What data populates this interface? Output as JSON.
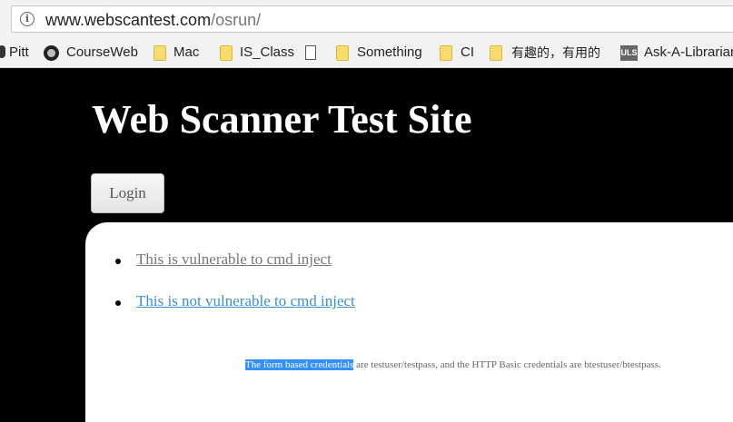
{
  "browser": {
    "url_host": "www.webscantest.com",
    "url_path": "/osrun/",
    "bookmarks": [
      {
        "label": "Pitt",
        "icon": "pitt-icon"
      },
      {
        "label": "CourseWeb",
        "icon": "courseweb-icon"
      },
      {
        "label": "Mac",
        "icon": "folder-icon"
      },
      {
        "label": "IS_Class",
        "icon": "folder-icon"
      },
      {
        "label": "",
        "icon": "page-icon"
      },
      {
        "label": "Something",
        "icon": "folder-icon"
      },
      {
        "label": "CI",
        "icon": "folder-icon"
      },
      {
        "label": "有趣的，有用的",
        "icon": "folder-icon"
      },
      {
        "label": "Ask-A-Librarian",
        "icon": "uls-icon",
        "icon_text": "ULS"
      }
    ]
  },
  "page": {
    "title": "Web Scanner Test Site",
    "login_label": "Login",
    "links": [
      {
        "label": "This is vulnerable to cmd inject",
        "state": "visited"
      },
      {
        "label": "This is not vulnerable to cmd inject",
        "state": "normal"
      }
    ],
    "note_highlighted": "The form based credentials",
    "note_rest": " are testuser/testpass, and the HTTP Basic credentials are btestuser/btestpass."
  },
  "colors": {
    "page_background": "#000000",
    "link": "#3d8fd1",
    "visited_link": "#777777",
    "selection": "#3390ff"
  }
}
